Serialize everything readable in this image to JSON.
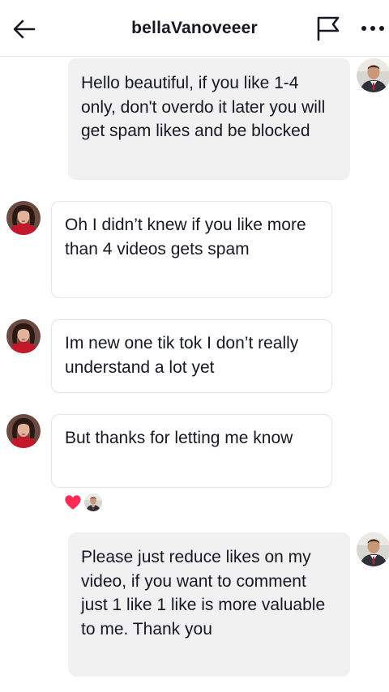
{
  "header": {
    "title": "bellaVanoveeer",
    "back_icon": "arrow-left-icon",
    "report_icon": "flag-icon",
    "more_icon": "more-horizontal-icon"
  },
  "messages": [
    {
      "sender": "self",
      "text": "Hello beautiful, if you like 1-4 only, don't overdo it later you will get spam likes and be blocked"
    },
    {
      "sender": "other",
      "text": "Oh I didn’t knew if you like more than 4 videos gets spam"
    },
    {
      "sender": "other",
      "text": "Im new one tik tok I don’t really understand a lot yet"
    },
    {
      "sender": "other",
      "text": "But thanks for letting me know",
      "reaction": "heart"
    },
    {
      "sender": "self",
      "text": "Please just reduce likes on my video, if you want to comment just 1 like 1 like is more valuable to me.  Thank you"
    }
  ],
  "colors": {
    "outgoing_bubble": "#f1f1f2",
    "incoming_border": "#e3e3e5",
    "heart": "#fe2c55"
  }
}
